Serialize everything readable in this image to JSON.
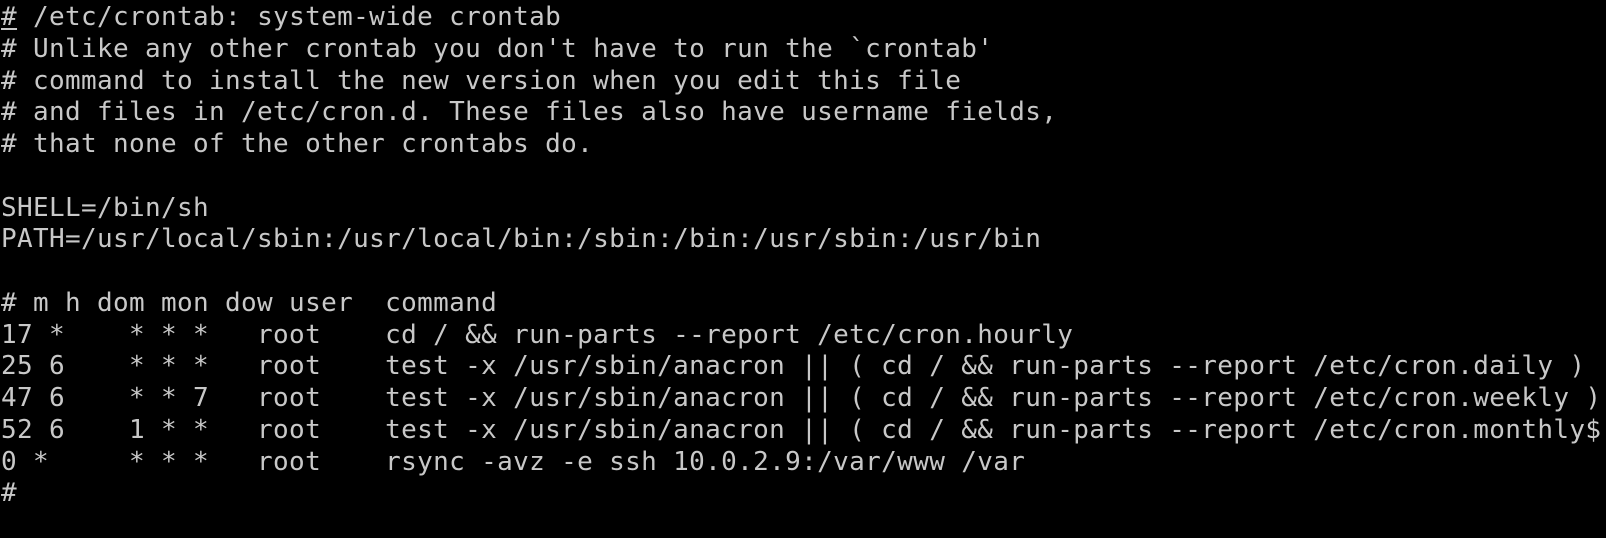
{
  "terminal": {
    "lines": [
      "# /etc/crontab: system-wide crontab",
      "# Unlike any other crontab you don't have to run the `crontab'",
      "# command to install the new version when you edit this file",
      "# and files in /etc/cron.d. These files also have username fields,",
      "# that none of the other crontabs do.",
      "",
      "SHELL=/bin/sh",
      "PATH=/usr/local/sbin:/usr/local/bin:/sbin:/bin:/usr/sbin:/usr/bin",
      "",
      "# m h dom mon dow user  command",
      "17 *    * * *   root    cd / && run-parts --report /etc/cron.hourly",
      "25 6    * * *   root    test -x /usr/sbin/anacron || ( cd / && run-parts --report /etc/cron.daily )",
      "47 6    * * 7   root    test -x /usr/sbin/anacron || ( cd / && run-parts --report /etc/cron.weekly )",
      "52 6    1 * *   root    test -x /usr/sbin/anacron || ( cd / && run-parts --report /etc/cron.monthly$",
      "0 *     * * *   root    rsync -avz -e ssh 10.0.2.9:/var/www /var",
      "#"
    ],
    "colors": {
      "background": "#000000",
      "foreground": "#c8c8c8"
    }
  }
}
